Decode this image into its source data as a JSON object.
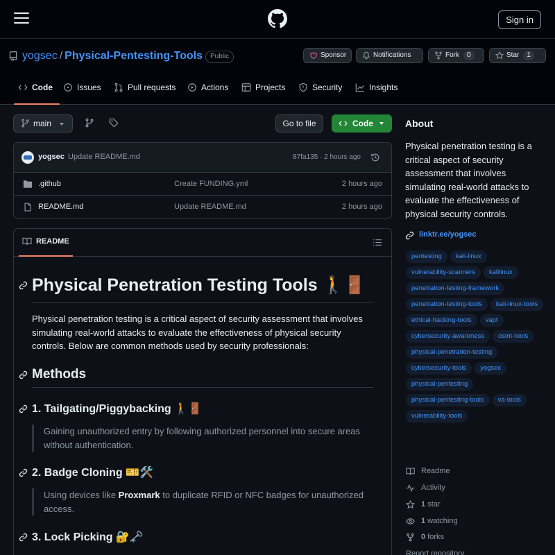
{
  "header": {
    "signin_label": "Sign in"
  },
  "repo": {
    "owner": "yogsec",
    "separator": "/",
    "name": "Physical-Pentesting-Tools",
    "visibility": "Public",
    "sponsor_label": "Sponsor",
    "notifications_label": "Notifications",
    "fork_label": "Fork",
    "fork_count": "0",
    "star_label": "Star",
    "star_count": "1",
    "sponsor_color": "#db61a2"
  },
  "tabs": [
    {
      "label": "Code",
      "icon": "code-icon",
      "active": true
    },
    {
      "label": "Issues",
      "icon": "issue-icon"
    },
    {
      "label": "Pull requests",
      "icon": "pull-request-icon"
    },
    {
      "label": "Actions",
      "icon": "play-icon"
    },
    {
      "label": "Projects",
      "icon": "table-icon"
    },
    {
      "label": "Security",
      "icon": "shield-icon"
    },
    {
      "label": "Insights",
      "icon": "graph-icon"
    }
  ],
  "toolbar": {
    "branch": "main",
    "goto_file": "Go to file",
    "code_label": "Code",
    "code_color": "#238636"
  },
  "commit": {
    "user": "yogsec",
    "message": "Update README.md",
    "meta": "87fa135 · 2 hours ago"
  },
  "files": [
    {
      "name": ".github",
      "message": "Create FUNDING.yml",
      "date": "2 hours ago",
      "type": "folder"
    },
    {
      "name": "README.md",
      "message": "Update README.md",
      "date": "2 hours ago",
      "type": "file"
    }
  ],
  "readme": {
    "tab_label": "README",
    "title": "Physical Penetration Testing Tools 🚶🚪",
    "intro": "Physical penetration testing is a critical aspect of security assessment that involves simulating real-world attacks to evaluate the effectiveness of physical security controls. Below are common methods used by security professionals:",
    "methods_heading": "Methods",
    "sections": [
      {
        "heading": "1. Tailgating/Piggybacking 🚶🚪",
        "quote": "Gaining unauthorized entry by following authorized personnel into secure areas without authentication."
      },
      {
        "heading": "2. Badge Cloning 🎫🛠️",
        "quote_before": "Using devices like ",
        "quote_bold": "Proxmark",
        "quote_after": " to duplicate RFID or NFC badges for unauthorized access."
      },
      {
        "heading": "3. Lock Picking 🔐🗝️"
      }
    ]
  },
  "about": {
    "heading": "About",
    "description": "Physical penetration testing is a critical aspect of security assessment that involves simulating real-world attacks to evaluate the effectiveness of physical security controls.",
    "link": "linktr.ee/yogsec",
    "topics": [
      "pentesting",
      "kali-linux",
      "vulnerability-scanners",
      "kalilinux",
      "penetration-testing-framework",
      "penetration-testing-tools",
      "kali-linux-tools",
      "ethical-hacking-tools",
      "vapt",
      "cybersecurity-awareness",
      "osint-tools",
      "physical-penetration-testing",
      "cybersecurity-tools",
      "yogsec",
      "physical-pentesting",
      "physical-pentesting-tools",
      "va-tools",
      "vulnerability-tools"
    ],
    "stats": {
      "readme": "Readme",
      "activity": "Activity",
      "stars_count": "1",
      "stars_label": "star",
      "watching_count": "1",
      "watching_label": "watching",
      "forks_count": "0",
      "forks_label": "forks",
      "report": "Report repository"
    }
  },
  "colors": {
    "accent_link": "#4493f8",
    "tab_underline": "#f78166",
    "background": "#0d1117"
  }
}
